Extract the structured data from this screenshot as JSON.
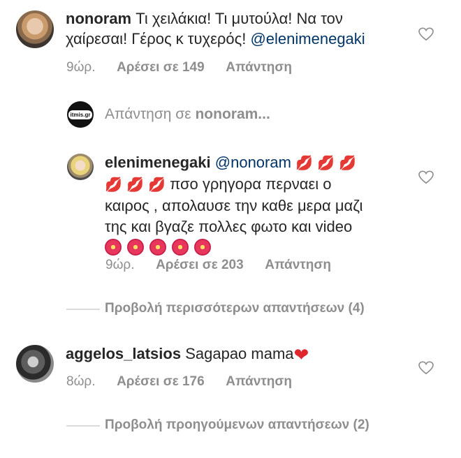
{
  "comments": [
    {
      "username": "nonoram",
      "text": "Τι χειλάκια! Τι μυτούλα! Να τον",
      "text_line2": "χαίρεσαι! Γέρος κ τυχερός!",
      "mention": "@elenimenegaki",
      "time": "9ώρ.",
      "likes": "Αρέσει σε 149",
      "reply": "Απάντηση"
    },
    {
      "username": "aggelos_latsios",
      "text": "Sagapao mama",
      "emoji": "❤",
      "time": "8ώρ.",
      "likes": "Αρέσει σε 176",
      "reply": "Απάντηση"
    }
  ],
  "reply_prompt": {
    "prefix": "Απάντηση σε",
    "username": "nonoram...",
    "brand_logo": "itmis.gr"
  },
  "reply": {
    "username": "elenimenegaki",
    "mention": "@nonoram",
    "line2": "πσο γρηγορα περναει ο",
    "line3": "καιρος , απολαυσε την καθε μερα μαζι",
    "line4": "της και βγαζε πολλες φωτο και video",
    "kiss_emoji": "💋",
    "flower_emoji": "🌺",
    "time": "9ώρ.",
    "likes": "Αρέσει σε 203",
    "reply": "Απάντηση"
  },
  "view_more_replies": "Προβολή περισσότερων απαντήσεων (4)",
  "view_previous_replies": "Προβολή προηγούμενων απαντήσεων (2)",
  "icons": {
    "like": "heart-outline-icon"
  }
}
